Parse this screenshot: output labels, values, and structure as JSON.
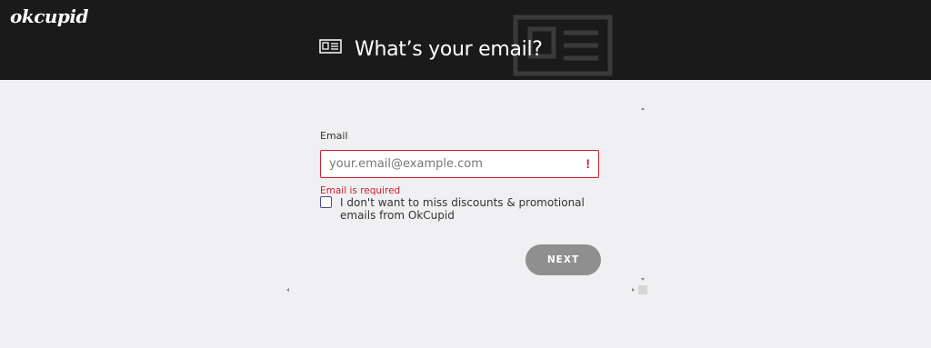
{
  "header": {
    "logo": "okcupid",
    "title": "What’s your email?",
    "title_icon": "id-card-icon"
  },
  "form": {
    "email_label": "Email",
    "email_placeholder": "your.email@example.com",
    "email_value": "",
    "alert_glyph": "!",
    "error_text": "Email is required",
    "optout_checked": false,
    "optout_label": "I don't want to miss discounts & promotional emails from OkCupid",
    "next_label": "NEXT"
  },
  "colors": {
    "header_bg": "#1a1a1a",
    "page_bg": "#f0f0f2",
    "error": "#c8202e",
    "button_disabled": "#8f8f8f"
  }
}
